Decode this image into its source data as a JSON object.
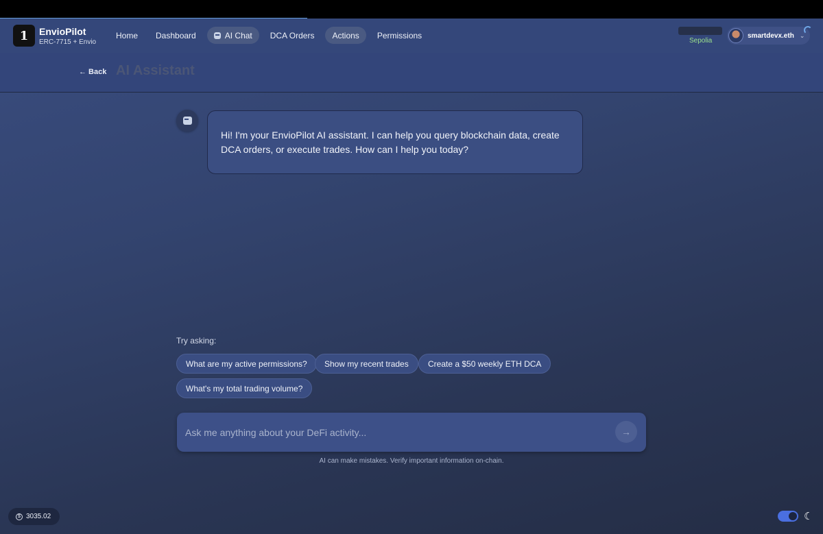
{
  "header": {
    "brand_name": "EnvioPilot",
    "brand_sub": "ERC-7715 + Envio",
    "logo_glyph": "1",
    "nav": [
      {
        "label": "Home"
      },
      {
        "label": "Dashboard"
      },
      {
        "label": "AI Chat"
      },
      {
        "label": "DCA Orders"
      },
      {
        "label": "Actions"
      },
      {
        "label": "Permissions"
      }
    ],
    "network": "Sepolia",
    "account": "smartdevx.eth"
  },
  "subheader": {
    "back_label": "← Back",
    "title": "AI Assistant"
  },
  "chat": {
    "messages": [
      {
        "role": "assistant",
        "text": "Hi! I'm your EnvioPilot AI assistant. I can help you query blockchain data, create DCA orders, or execute trades. How can I help you today?"
      }
    ],
    "try_label": "Try asking:",
    "suggestions": [
      "What are my active permissions?",
      "Show my recent trades",
      "Create a $50 weekly ETH DCA",
      "What's my total trading volume?"
    ],
    "input_placeholder": "Ask me anything about your DeFi activity...",
    "disclaimer": "AI can make mistakes. Verify important information on-chain."
  },
  "footer": {
    "price": "3035.02",
    "theme": "dark"
  },
  "colors": {
    "accent": "#6fa6e6",
    "network_green": "#9be08c",
    "toggle": "#4a6fe0"
  }
}
